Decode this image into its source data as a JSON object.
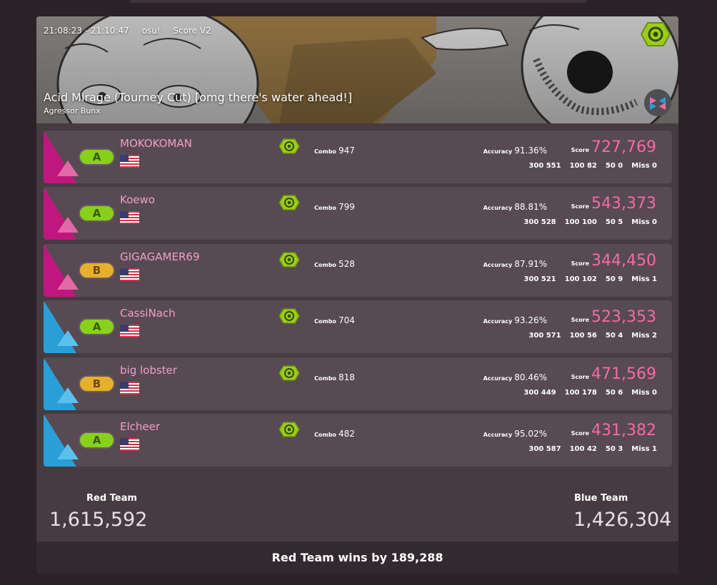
{
  "header": {
    "time_range": "21:08:23 - 21:10:47",
    "mode": "osu!",
    "scoring": "Score V2",
    "map_title": "Acid Mirage (Tourney Cut) [omg there's water ahead!]",
    "map_artist": "Agressor Bunx",
    "mod_icon": "nofail-mod-icon",
    "mode_icon": "team-vs-icon"
  },
  "labels": {
    "combo": "Combo",
    "accuracy": "Accuracy",
    "score": "Score",
    "h300": "300",
    "h100": "100",
    "h50": "50",
    "miss": "Miss"
  },
  "players": [
    {
      "name": "MOKOKOMAN",
      "team": "red",
      "grade": "A",
      "flag": "us-flag-icon",
      "combo": "947",
      "accuracy": "91.36%",
      "score": "727,769",
      "h300": "551",
      "h100": "82",
      "h50": "0",
      "miss": "0"
    },
    {
      "name": "Koewo",
      "team": "red",
      "grade": "A",
      "flag": "us-flag-icon",
      "combo": "799",
      "accuracy": "88.81%",
      "score": "543,373",
      "h300": "528",
      "h100": "100",
      "h50": "5",
      "miss": "0"
    },
    {
      "name": "GIGAGAMER69",
      "team": "red",
      "grade": "B",
      "flag": "us-flag-icon",
      "combo": "528",
      "accuracy": "87.91%",
      "score": "344,450",
      "h300": "521",
      "h100": "102",
      "h50": "9",
      "miss": "1"
    },
    {
      "name": "CassiNach",
      "team": "blue",
      "grade": "A",
      "flag": "us-flag-icon",
      "combo": "704",
      "accuracy": "93.26%",
      "score": "523,353",
      "h300": "571",
      "h100": "56",
      "h50": "4",
      "miss": "2"
    },
    {
      "name": "big lobster",
      "team": "blue",
      "grade": "B",
      "flag": "us-flag-icon",
      "combo": "818",
      "accuracy": "80.46%",
      "score": "471,569",
      "h300": "449",
      "h100": "178",
      "h50": "6",
      "miss": "0"
    },
    {
      "name": "Elcheer",
      "team": "blue",
      "grade": "A",
      "flag": "us-flag-icon",
      "combo": "482",
      "accuracy": "95.02%",
      "score": "431,382",
      "h300": "587",
      "h100": "42",
      "h50": "3",
      "miss": "1"
    }
  ],
  "teams": {
    "red": {
      "label": "Red Team",
      "total": "1,615,592"
    },
    "blue": {
      "label": "Blue Team",
      "total": "1,426,304"
    }
  },
  "result": "Red Team wins by 189,288",
  "colors": {
    "red_team": "#c0177f",
    "blue_team": "#2a9fd6",
    "score": "#f56aa6",
    "player_name": "#f0a0c8",
    "mod_green": "#9ccc1a",
    "grade_a": "#88d11b",
    "grade_b": "#e7b02c"
  }
}
